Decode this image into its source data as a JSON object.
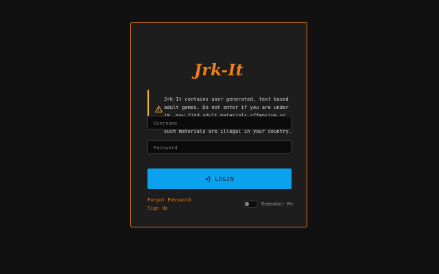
{
  "app": {
    "logo_text": "Jrk-It"
  },
  "warning": {
    "icon": "warning-triangle-icon",
    "accent_color": "#f1b53c",
    "text": "Jrk-It contains user generated, text based\nadult games. Do not enter if you are under\n18, may find adult materials offensive or if\nsuch materials are illegal in your country."
  },
  "form": {
    "username_placeholder": "Username",
    "username_value": "",
    "password_placeholder": "Password",
    "password_value": "",
    "login_label": "LOGIN",
    "login_icon": "sign-in-icon",
    "forgot_password_label": "Forgot Password",
    "sign_up_label": "Sign Up",
    "remember_me_label": "Remember Me",
    "remember_me_checked": false
  },
  "colors": {
    "background": "#111111",
    "card": "#1d1d1d",
    "card_border": "#e8791a",
    "logo": "#f07f14",
    "button": "#0aa2ef",
    "link": "#e57b1b"
  }
}
